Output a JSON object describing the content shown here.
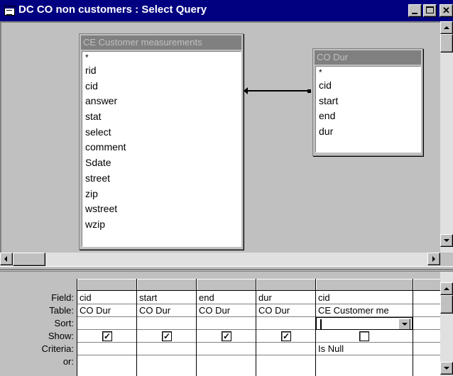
{
  "window": {
    "title": "DC CO non customers : Select Query"
  },
  "tables": [
    {
      "name": "CE Customer measurements",
      "fields": [
        "*",
        "rid",
        "cid",
        "answer",
        "stat",
        "select",
        "comment",
        "Sdate",
        "street",
        "zip",
        "wstreet",
        "wzip"
      ]
    },
    {
      "name": "CO Dur",
      "fields": [
        "*",
        "cid",
        "start",
        "end",
        "dur"
      ]
    }
  ],
  "grid": {
    "row_labels": {
      "field": "Field:",
      "table": "Table:",
      "sort": "Sort:",
      "show": "Show:",
      "criteria": "Criteria:",
      "or": "or:"
    },
    "columns": [
      {
        "field": "cid",
        "table": "CO Dur",
        "sort": "",
        "show": true,
        "criteria": ""
      },
      {
        "field": "start",
        "table": "CO Dur",
        "sort": "",
        "show": true,
        "criteria": ""
      },
      {
        "field": "end",
        "table": "CO Dur",
        "sort": "",
        "show": true,
        "criteria": ""
      },
      {
        "field": "dur",
        "table": "CO Dur",
        "sort": "",
        "show": true,
        "criteria": ""
      },
      {
        "field": "cid",
        "table": "CE Customer me",
        "sort": "",
        "show": false,
        "criteria": "Is Null"
      }
    ],
    "check_mark": "✓"
  },
  "colors": {
    "title_bar": "#000080",
    "face": "#c0c0c0",
    "list_title": "#808080"
  }
}
